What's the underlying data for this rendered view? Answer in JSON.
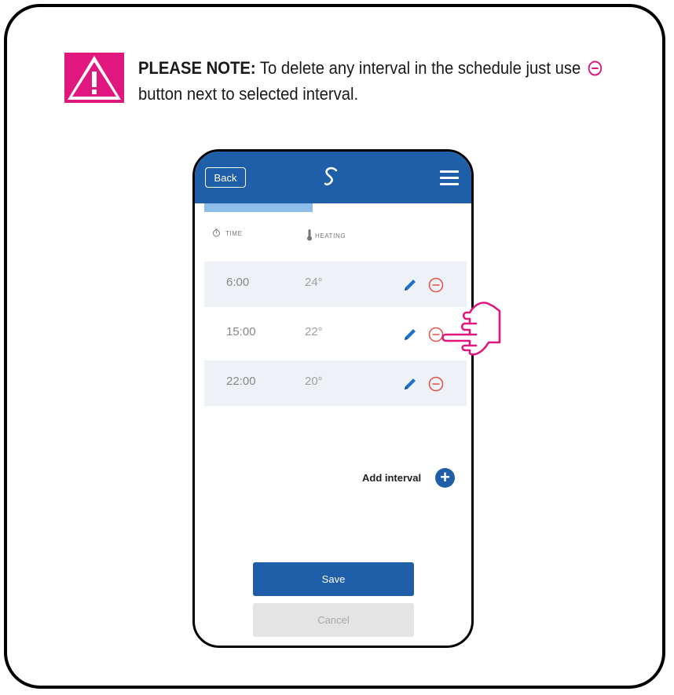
{
  "note": {
    "bold_label": "PLEASE NOTE:",
    "text_before_icon": " To delete any interval in the schedule just use",
    "text_after_icon": "button next to selected interval.",
    "warning_icon": "warning-triangle-icon",
    "accent_color": "#e0177f"
  },
  "app": {
    "back_label": "Back",
    "logo_icon": "salus-logo-icon",
    "menu_icon": "hamburger-menu-icon",
    "brand_color": "#1f5ea8"
  },
  "schedule": {
    "columns": {
      "time": "TIME",
      "heating": "HEATING"
    },
    "rows": [
      {
        "time": "6:00",
        "temp": "24°"
      },
      {
        "time": "15:00",
        "temp": "22°"
      },
      {
        "time": "22:00",
        "temp": "20°"
      }
    ]
  },
  "actions": {
    "add_interval": "Add interval",
    "save": "Save",
    "cancel": "Cancel"
  }
}
